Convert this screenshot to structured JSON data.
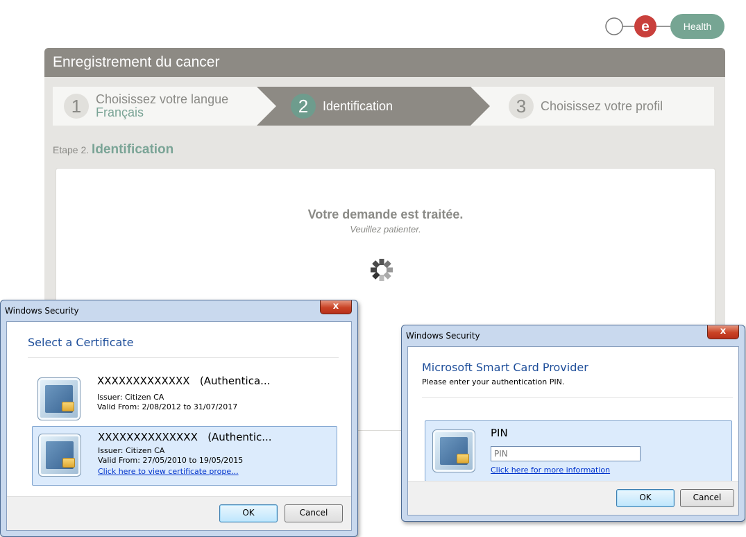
{
  "logo": {
    "text": "Health",
    "letter": "e"
  },
  "panel": {
    "title": "Enregistrement du cancer",
    "steps": [
      {
        "num": "1",
        "label": "Choisissez votre langue",
        "sub": "Français"
      },
      {
        "num": "2",
        "label": "Identification"
      },
      {
        "num": "3",
        "label": "Choisissez votre profil"
      }
    ],
    "etape_prefix": "Etape 2.",
    "etape_title": "Identification",
    "message_title": "Votre demande est traitée.",
    "message_sub": "Veuillez patienter."
  },
  "cert_dialog": {
    "window_title": "Windows Security",
    "close_label": "x",
    "heading": "Select a Certificate",
    "certificates": [
      {
        "name": "XXXXXXXXXXXXX",
        "type": "(Authentica...",
        "issuer": "Issuer: Citizen CA",
        "valid": "Valid From: 2/08/2012 to 31/07/2017"
      },
      {
        "name": "XXXXXXXXXXXXXX",
        "type": "(Authentic...",
        "issuer": "Issuer: Citizen CA",
        "valid": "Valid From: 27/05/2010 to 19/05/2015",
        "link": "Click here to view certificate prope..."
      }
    ],
    "ok": "OK",
    "cancel": "Cancel"
  },
  "pin_dialog": {
    "window_title": "Windows Security",
    "close_label": "x",
    "heading": "Microsoft Smart Card Provider",
    "subtext": "Please enter your authentication PIN.",
    "pin_label": "PIN",
    "pin_placeholder": "PIN",
    "info_link": "Click here for more information",
    "ok": "OK",
    "cancel": "Cancel"
  }
}
